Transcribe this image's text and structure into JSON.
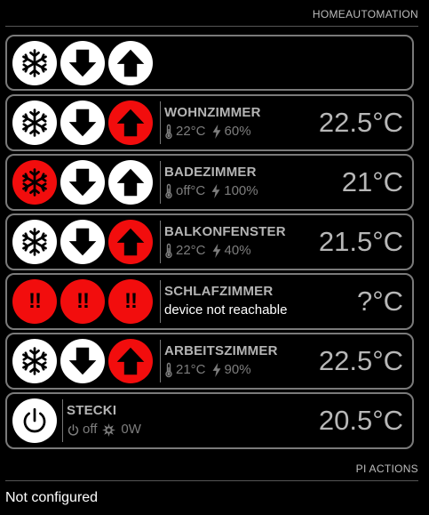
{
  "sections": {
    "home_automation": "HOMEAUTOMATION",
    "pi_actions": "PI ACTIONS",
    "pi_actions_status": "Not configured"
  },
  "colors": {
    "background": "#000000",
    "active_red": "#f20d0d",
    "inactive_white": "#ffffff",
    "card_border": "#7a7a7a",
    "muted_text": "#7d7d7d",
    "name_text": "#b4b4b4"
  },
  "icons": {
    "frost": "snowflake-icon",
    "down": "arrow-down-icon",
    "up": "arrow-up-icon",
    "error": "exclamation-icon",
    "power": "power-icon",
    "thermometer": "thermometer-icon",
    "bolt": "bolt-icon",
    "energy": "burst-icon"
  },
  "all_rooms": {
    "buttons": [
      {
        "icon": "snowflake-icon",
        "active": false
      },
      {
        "icon": "arrow-down-icon",
        "active": false
      },
      {
        "icon": "arrow-up-icon",
        "active": false
      }
    ]
  },
  "rooms": [
    {
      "name": "WOHNZIMMER",
      "current_temp": "22°C",
      "valve": "60%",
      "target": "22.5°C",
      "buttons": [
        {
          "icon": "snowflake-icon",
          "active": false
        },
        {
          "icon": "arrow-down-icon",
          "active": false
        },
        {
          "icon": "arrow-up-icon",
          "active": true
        }
      ]
    },
    {
      "name": "BADEZIMMER",
      "current_temp": "off°C",
      "valve": "100%",
      "target": "21°C",
      "buttons": [
        {
          "icon": "snowflake-icon",
          "active": true
        },
        {
          "icon": "arrow-down-icon",
          "active": false
        },
        {
          "icon": "arrow-up-icon",
          "active": false
        }
      ]
    },
    {
      "name": "BALKONFENSTER",
      "current_temp": "22°C",
      "valve": "40%",
      "target": "21.5°C",
      "buttons": [
        {
          "icon": "snowflake-icon",
          "active": false
        },
        {
          "icon": "arrow-down-icon",
          "active": false
        },
        {
          "icon": "arrow-up-icon",
          "active": true
        }
      ]
    },
    {
      "name": "SCHLAFZIMMER",
      "status": "device not reachable",
      "target": "?°C",
      "buttons": [
        {
          "icon": "exclamation-icon",
          "active": true,
          "label": "!!"
        },
        {
          "icon": "exclamation-icon",
          "active": true,
          "label": "!!"
        },
        {
          "icon": "exclamation-icon",
          "active": true,
          "label": "!!"
        }
      ]
    },
    {
      "name": "ARBEITSZIMMER",
      "current_temp": "21°C",
      "valve": "90%",
      "target": "22.5°C",
      "buttons": [
        {
          "icon": "snowflake-icon",
          "active": false
        },
        {
          "icon": "arrow-down-icon",
          "active": false
        },
        {
          "icon": "arrow-up-icon",
          "active": true
        }
      ]
    }
  ],
  "plug": {
    "name": "STECKI",
    "state": "off",
    "power": "0W",
    "temp": "20.5°C"
  }
}
